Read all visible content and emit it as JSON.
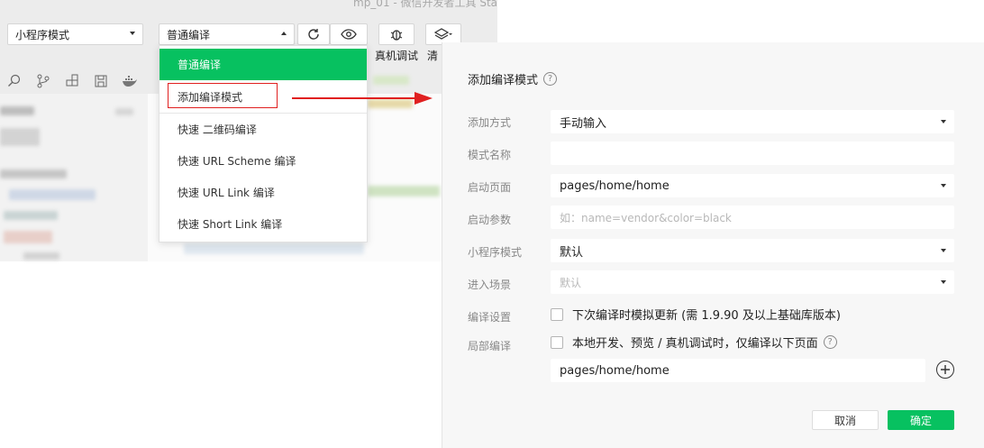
{
  "ide": {
    "title_fragment": "mp_01 - 微信开发者工具 Sta",
    "mode_select": "小程序模式",
    "compile_select": "普通编译",
    "toolbar_labels": {
      "device_debug": "真机调试",
      "clear": "清"
    }
  },
  "compile_menu": {
    "items": [
      {
        "label": "普通编译",
        "active": true
      },
      {
        "label": "添加编译模式",
        "highlighted": true
      },
      {
        "label": "快速 二维码编译"
      },
      {
        "label": "快速 URL Scheme 编译"
      },
      {
        "label": "快速 URL Link 编译"
      },
      {
        "label": "快速 Short Link 编译"
      }
    ]
  },
  "dialog": {
    "title": "添加编译模式",
    "add_method": {
      "label": "添加方式",
      "value": "手动输入"
    },
    "mode_name": {
      "label": "模式名称",
      "value": ""
    },
    "start_page": {
      "label": "启动页面",
      "value": "pages/home/home"
    },
    "start_params": {
      "label": "启动参数",
      "placeholder": "如：name=vendor&color=black"
    },
    "mini_mode": {
      "label": "小程序模式",
      "value": "默认"
    },
    "enter_scene": {
      "label": "进入场景",
      "value": "默认"
    },
    "compile_settings": {
      "label": "编译设置",
      "checkbox": "下次编译时模拟更新 (需 1.9.90 及以上基础库版本)",
      "checked": false
    },
    "partial_compile": {
      "label": "局部编译",
      "checkbox": "本地开发、预览 / 真机调试时，仅编译以下页面",
      "checked": false,
      "page": "pages/home/home"
    },
    "cancel_label": "取消",
    "confirm_label": "确定"
  },
  "colors": {
    "accent": "#07c160",
    "highlight_border": "#e02020",
    "arrow": "#e02020"
  }
}
